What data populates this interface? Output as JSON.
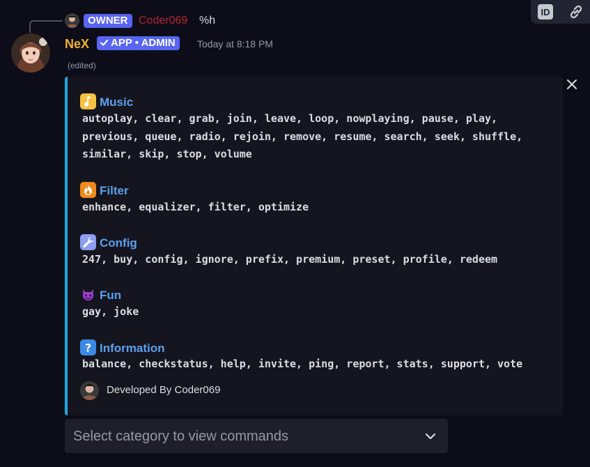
{
  "reply": {
    "badge": "OWNER",
    "author": "Coder069",
    "content": "%h"
  },
  "message": {
    "author": "NeX",
    "app_badge": "APP • ADMIN",
    "timestamp": "Today at 8:18 PM",
    "edited": "(edited)"
  },
  "embed": {
    "accent_color": "#21a8e0",
    "sections": [
      {
        "title": "Music",
        "icon": "musical-note-icon",
        "commands_lines": [
          "autoplay, clear, grab, join, leave, loop, nowplaying, pause, play,",
          "previous, queue, radio, rejoin, remove, resume, search, seek, shuffle,",
          "similar, skip, stop, volume"
        ]
      },
      {
        "title": "Filter",
        "icon": "fire-icon",
        "commands_lines": [
          "enhance, equalizer, filter, optimize"
        ]
      },
      {
        "title": "Config",
        "icon": "wrench-icon",
        "commands_lines": [
          "247, buy, config, ignore, prefix, premium, preset, profile, redeem"
        ]
      },
      {
        "title": "Fun",
        "icon": "imp-icon",
        "commands_lines": [
          "gay, joke"
        ]
      },
      {
        "title": "Information",
        "icon": "question-icon",
        "commands_lines": [
          "balance, checkstatus, help, invite, ping, report, stats, support, vote"
        ]
      }
    ],
    "footer": "Developed By Coder069"
  },
  "select_menu": {
    "placeholder": "Select category to view commands"
  }
}
